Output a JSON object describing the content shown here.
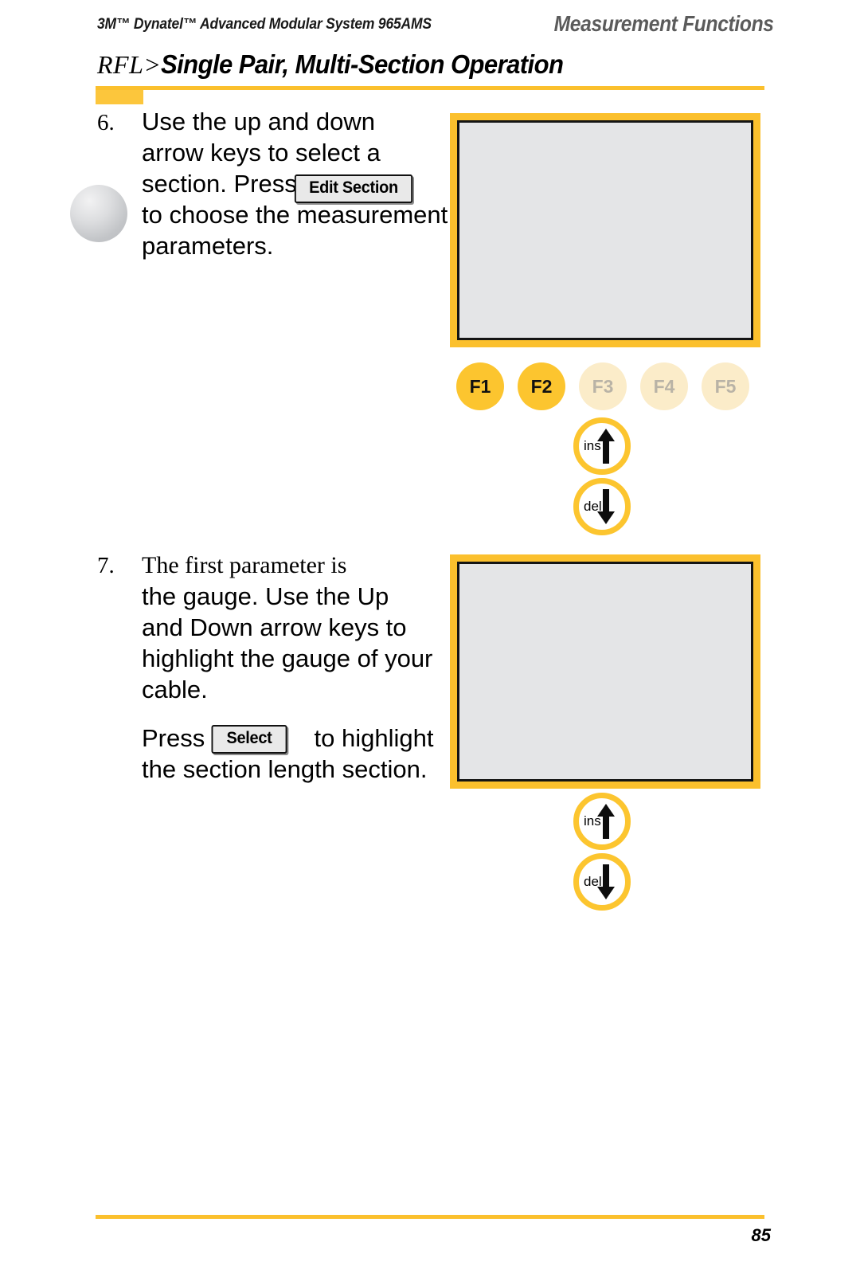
{
  "header": {
    "left_text": "3M™ Dynatel™ Advanced Modular System 965AMS",
    "right_text": "Measurement Functions",
    "title_prefix": "RFL>",
    "title_main": "Single Pair, Multi-Section Operation"
  },
  "accent_colors": {
    "rule_yellow": "#fbc02d",
    "key_yellow": "#fcc52f",
    "key_yellow_dim": "#fbecc9",
    "screen_gray": "#e4e5e7",
    "header_gray": "#5b5b5b"
  },
  "steps": [
    {
      "number": "6.",
      "lines": [
        "Use the up and down",
        "arrow keys to select a",
        "section. Press",
        "to choose the measurement",
        "parameters."
      ],
      "inline_button": "Edit Section"
    },
    {
      "number": "7.",
      "lines": [
        "The first parameter is",
        "the gauge. Use the Up",
        "and Down arrow keys to",
        "highlight the gauge of your",
        "cable."
      ],
      "paragraph2_pre": "Press",
      "inline_button": "Select",
      "paragraph2_post": "to highlight",
      "paragraph2_line2": "the section length section."
    }
  ],
  "device_one": {
    "fkeys": [
      {
        "label": "F1",
        "state": "active"
      },
      {
        "label": "F2",
        "state": "active"
      },
      {
        "label": "F3",
        "state": "dim"
      },
      {
        "label": "F4",
        "state": "dim"
      },
      {
        "label": "F5",
        "state": "dim"
      }
    ],
    "ins_label": "ins",
    "del_label": "del"
  },
  "device_two": {
    "ins_label": "ins",
    "del_label": "del"
  },
  "footer": {
    "page_number": "85"
  }
}
